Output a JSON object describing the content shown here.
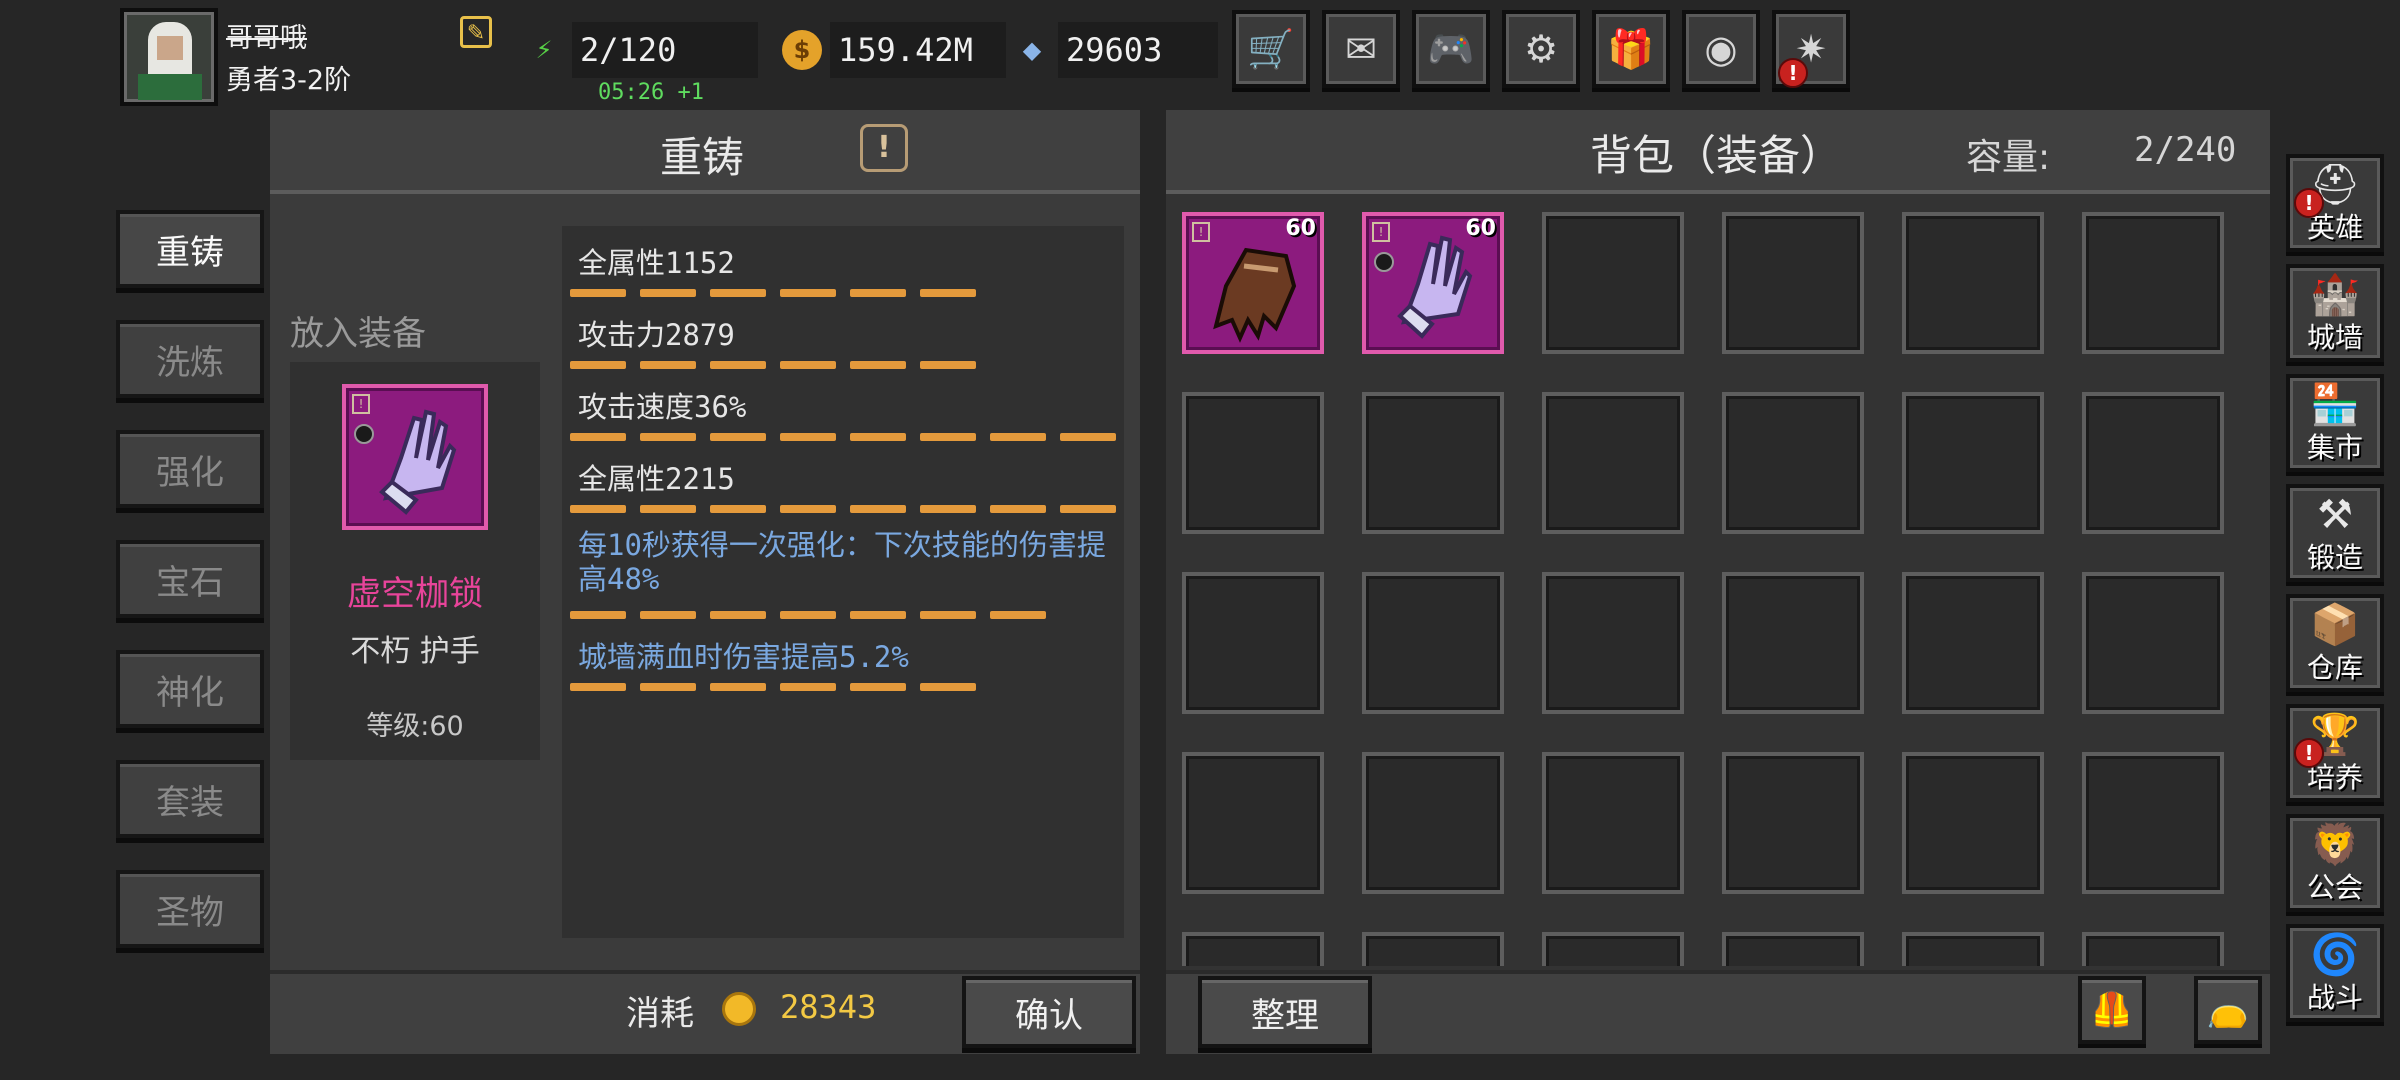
{
  "player": {
    "name": "哥哥哦",
    "rank": "勇者3-2阶"
  },
  "resources": {
    "energy": "2/120",
    "energy_timer": "05:26 +1",
    "gold": "159.42M",
    "gems": "29603"
  },
  "top_buttons": [
    {
      "name": "shop",
      "icon": "cart-icon",
      "glyph": "🛒"
    },
    {
      "name": "mail",
      "icon": "mail-icon",
      "glyph": "✉"
    },
    {
      "name": "game",
      "icon": "gamepad-icon",
      "glyph": "🎮"
    },
    {
      "name": "settings",
      "icon": "gear-icon",
      "glyph": "⚙"
    },
    {
      "name": "gift",
      "icon": "gift-icon",
      "glyph": "🎁"
    },
    {
      "name": "wheel",
      "icon": "color-wheel-icon",
      "glyph": "◉"
    },
    {
      "name": "fireworks",
      "icon": "fireworks-icon",
      "glyph": "✷",
      "badge": "!"
    }
  ],
  "left_tabs": [
    "重铸",
    "洗炼",
    "强化",
    "宝石",
    "神化",
    "套装",
    "圣物"
  ],
  "active_tab": "重铸",
  "reforge": {
    "title": "重铸",
    "info_glyph": "!",
    "put_label": "放入装备",
    "item": {
      "name": "虚空枷锁",
      "type": "不朽 护手",
      "level_text": "等级:60"
    },
    "stats": [
      {
        "text": "全属性1152",
        "color": "white",
        "dashes": 6
      },
      {
        "text": "攻击力2879",
        "color": "white",
        "dashes": 6
      },
      {
        "text": "攻击速度36%",
        "color": "white",
        "dashes": 8
      },
      {
        "text": "全属性2215",
        "color": "white",
        "dashes": 8
      },
      {
        "text": "每10秒获得一次强化：下次技能的伤害提高48%",
        "color": "blue",
        "dashes": 7
      },
      {
        "text": "城墙满血时伤害提高5.2%",
        "color": "blue",
        "dashes": 6
      }
    ],
    "cost_label": "消耗",
    "cost_value": "28343",
    "confirm_label": "确认"
  },
  "bag": {
    "title": "背包（装备）",
    "capacity_label": "容量:",
    "capacity_value": "2/240",
    "items": [
      {
        "level": "60",
        "kind": "gauntlet-brown"
      },
      {
        "level": "60",
        "kind": "gauntlet-violet"
      }
    ],
    "sort_label": "整理"
  },
  "right_nav": [
    {
      "label": "英雄",
      "icon": "helmet-icon",
      "glyph": "⛑",
      "badge": "!"
    },
    {
      "label": "城墙",
      "icon": "wall-icon",
      "glyph": "🏰"
    },
    {
      "label": "集市",
      "icon": "market-icon",
      "glyph": "🏪"
    },
    {
      "label": "锻造",
      "icon": "anvil-icon",
      "glyph": "⚒"
    },
    {
      "label": "仓库",
      "icon": "warehouse-icon",
      "glyph": "📦"
    },
    {
      "label": "培养",
      "icon": "chalice-icon",
      "glyph": "🏆",
      "badge": "!"
    },
    {
      "label": "公会",
      "icon": "guild-icon",
      "glyph": "🦁"
    },
    {
      "label": "战斗",
      "icon": "portal-icon",
      "glyph": "🌀"
    }
  ],
  "colors": {
    "accent_orange": "#e49a3c",
    "item_pink": "#e8449a",
    "stat_blue": "#7aa8e0",
    "gold": "#f3c944"
  }
}
